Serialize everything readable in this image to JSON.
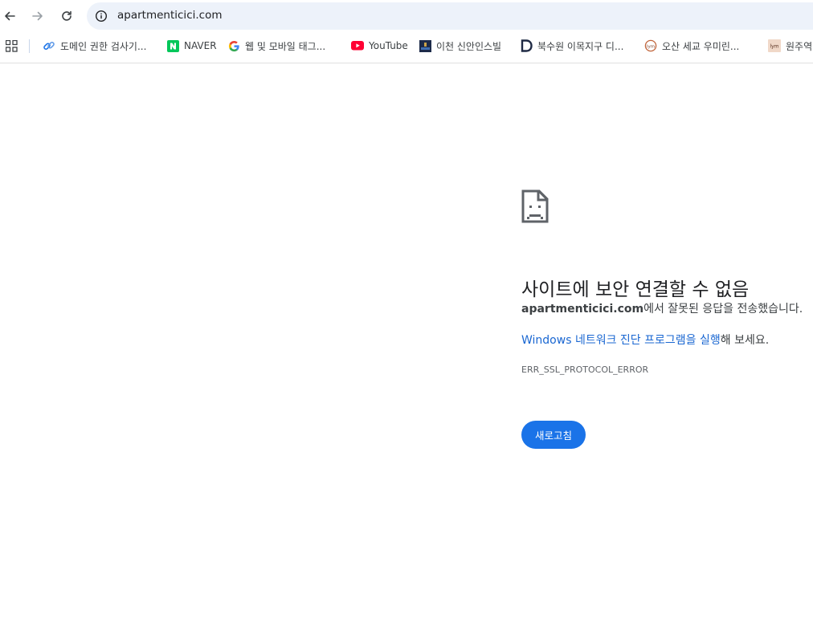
{
  "browser": {
    "url": "apartmenticici.com",
    "bookmarks": [
      {
        "label": "도메인 권한 검사기...",
        "icon": "link-icon"
      },
      {
        "label": "NAVER",
        "icon": "naver-icon"
      },
      {
        "label": "웹 및 모바일 태그...",
        "icon": "google-icon"
      },
      {
        "label": "YouTube",
        "icon": "youtube-icon"
      },
      {
        "label": "이천 신안인스빌",
        "icon": "site-thumbnail-icon"
      },
      {
        "label": "북수원 이목지구 디...",
        "icon": "d-logo-icon"
      },
      {
        "label": "오산 세교 우미린...",
        "icon": "lym-circle-icon"
      },
      {
        "label": "원주역",
        "icon": "lym-square-icon"
      }
    ]
  },
  "error": {
    "title": "사이트에 보안 연결할 수 없음",
    "host": "apartmenticici.com",
    "description_suffix": "에서 잘못된 응답을 전송했습니다.",
    "suggestion_link": "Windows 네트워크 진단 프로그램을 실행",
    "suggestion_suffix": "해 보세요.",
    "code": "ERR_SSL_PROTOCOL_ERROR",
    "reload_label": "새로고침"
  },
  "colors": {
    "accent": "#1a73e8",
    "link": "#1a67d2",
    "omnibox_bg": "#edf2fa"
  }
}
